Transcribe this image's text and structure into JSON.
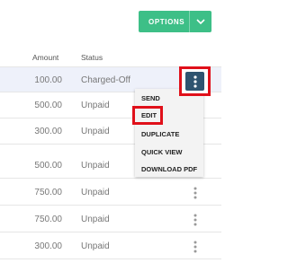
{
  "toolbar": {
    "options_label": "OPTIONS",
    "options_icon": "chevron-down-icon",
    "accent": "#3dbf87"
  },
  "table": {
    "headers": {
      "amount": "Amount",
      "status": "Status"
    },
    "rows": [
      {
        "amount": "100.00",
        "status": "Charged-Off"
      },
      {
        "amount": "500.00",
        "status": "Unpaid"
      },
      {
        "amount": "300.00",
        "status": "Unpaid"
      },
      {
        "amount": "500.00",
        "status": "Unpaid"
      },
      {
        "amount": "750.00",
        "status": "Unpaid"
      },
      {
        "amount": "750.00",
        "status": "Unpaid"
      },
      {
        "amount": "300.00",
        "status": "Unpaid"
      }
    ]
  },
  "menu": {
    "items": [
      "SEND",
      "EDIT",
      "DUPLICATE",
      "QUICK VIEW",
      "DOWNLOAD PDF"
    ]
  },
  "colors": {
    "highlight": "#e0101a",
    "kebab_active_bg": "#2f5470",
    "selected_row_bg": "#eef1fa"
  }
}
